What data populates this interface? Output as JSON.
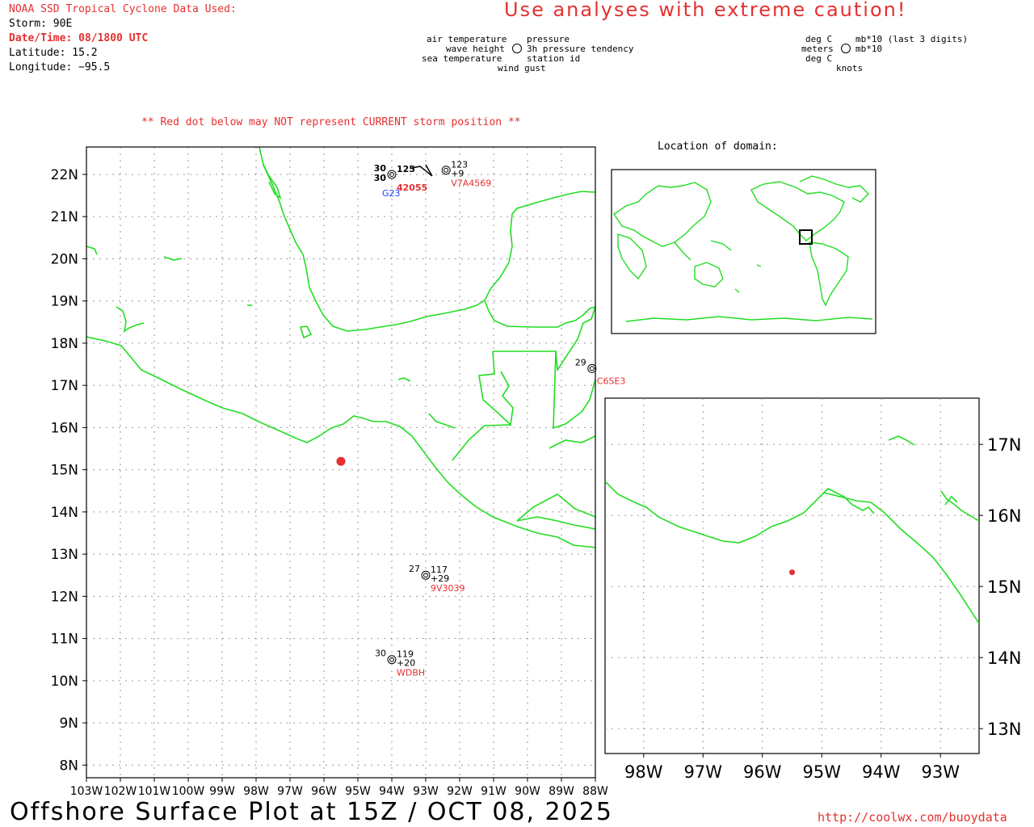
{
  "header": {
    "title": "NOAA SSD Tropical Cyclone Data Used:",
    "storm": "Storm: 90E",
    "datetime": "Date/Time: 08/1800 UTC",
    "latitude": "Latitude: 15.2",
    "longitude": "Longitude: −95.5"
  },
  "caution": "Use analyses with extreme caution!",
  "legend": {
    "air_temperature": "air temperature",
    "wave_height": "wave height",
    "sea_temperature": "sea temperature",
    "pressure": "pressure",
    "pressure_tendency": "3h pressure tendency",
    "station_id": "station id",
    "wind_gust": "wind gust",
    "deg_c_1": "deg C",
    "meters": "meters",
    "deg_c_2": "deg C",
    "mb10_last3": "mb*10 (last 3 digits)",
    "mb10": "mb*10",
    "knots": "knots"
  },
  "notice": "** Red dot below may NOT represent CURRENT storm position **",
  "location_label": "Location of domain:",
  "main_map": {
    "lat_labels": [
      "22N",
      "21N",
      "20N",
      "19N",
      "18N",
      "17N",
      "16N",
      "15N",
      "14N",
      "13N",
      "12N",
      "11N",
      "10N",
      "9N",
      "8N"
    ],
    "lon_labels": [
      "103W",
      "102W",
      "101W",
      "100W",
      "99W",
      "98W",
      "97W",
      "96W",
      "95W",
      "94W",
      "93W",
      "92W",
      "91W",
      "90W",
      "89W",
      "88W"
    ]
  },
  "zoom_map": {
    "lat_labels": [
      "17N",
      "16N",
      "15N",
      "14N",
      "13N"
    ],
    "lon_labels": [
      "98W",
      "97W",
      "96W",
      "95W",
      "94W",
      "93W"
    ]
  },
  "storm_position": {
    "lat": 15.2,
    "lon": -95.5
  },
  "stations": [
    {
      "id": "42055",
      "air": "30",
      "sea": "30",
      "pressure": "125",
      "tendency": "",
      "buoy_type": "G23",
      "lat": 22.0,
      "lon": -94.0
    },
    {
      "id": "V7A4569",
      "air": "",
      "sea": "",
      "pressure": "123",
      "tendency": "+9",
      "lat": 22.1,
      "lon": -92.4
    },
    {
      "id": "C6SE3",
      "air": "29",
      "sea": "",
      "pressure": "",
      "tendency": "",
      "lat": 17.4,
      "lon": -88.1
    },
    {
      "id": "9V3039",
      "air": "27",
      "sea": "",
      "pressure": "117",
      "tendency": "+29",
      "lat": 12.5,
      "lon": -93.0
    },
    {
      "id": "WDBH",
      "air": "30",
      "sea": "",
      "pressure": "119",
      "tendency": "+20",
      "lat": 10.5,
      "lon": -94.0
    }
  ],
  "footer": {
    "title": "Offshore Surface Plot at 15Z / OCT 08, 2025",
    "url": "http://coolwx.com/buoydata"
  },
  "colors": {
    "land": "#22dd22",
    "accent": "#e53030",
    "buoy": "#1e40ff",
    "grid": "#9a9a9a"
  }
}
